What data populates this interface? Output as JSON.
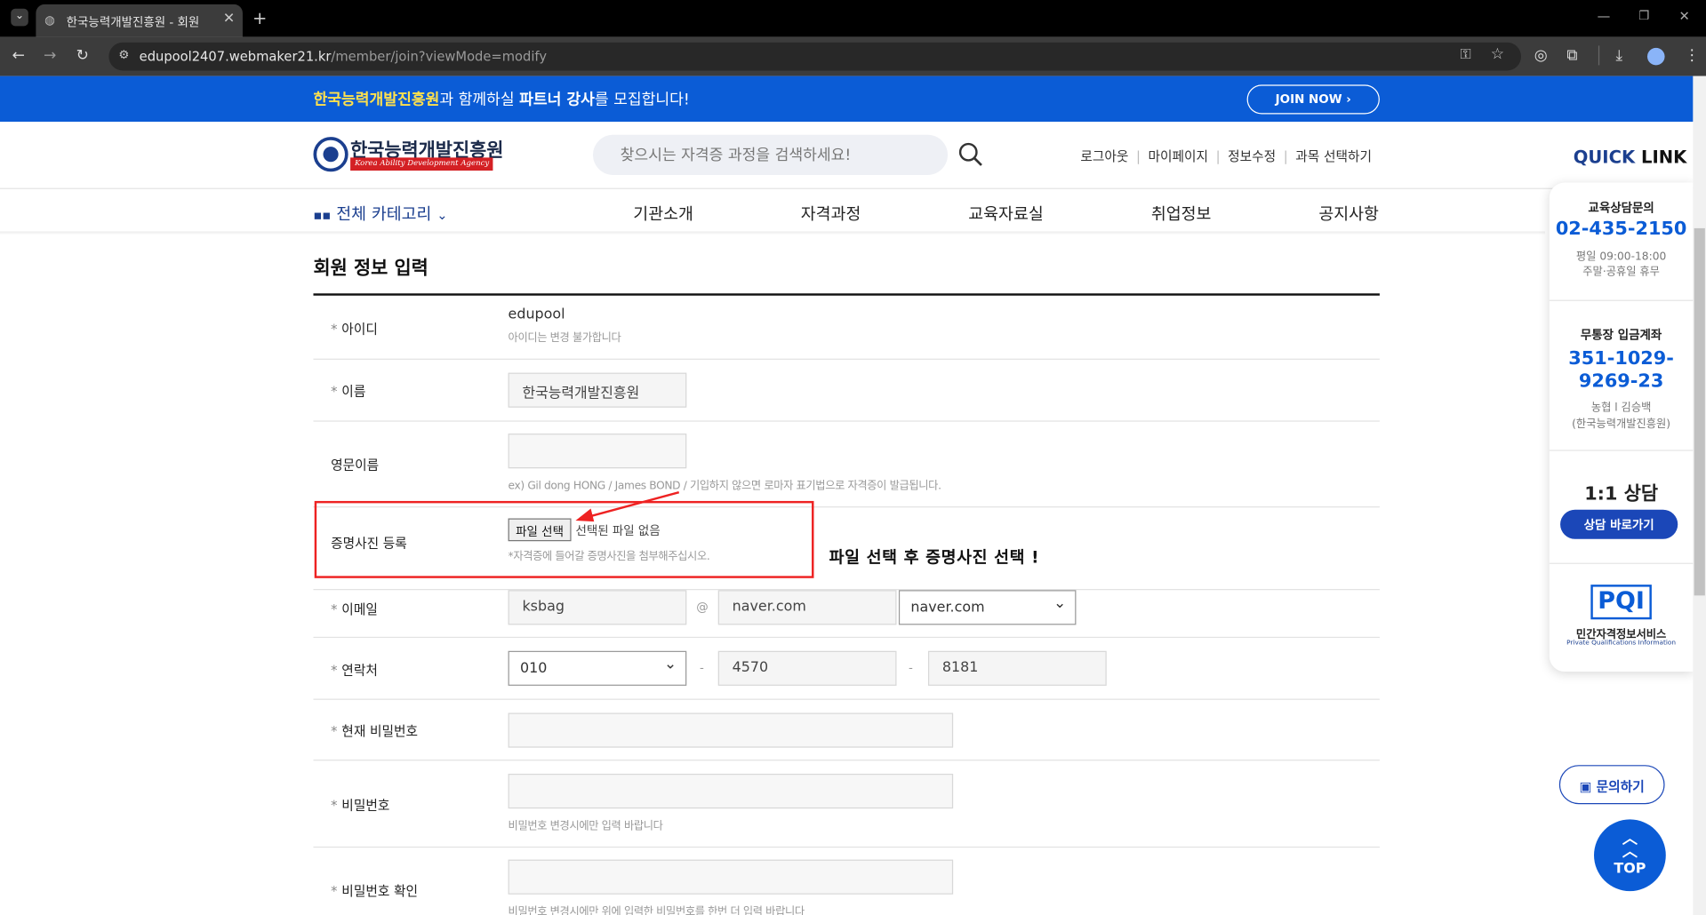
{
  "browser": {
    "tab_title": "한국능력개발진흥원 - 회원",
    "url_host": "edupool2407.webmaker21.kr",
    "url_path": "/member/join?viewMode=modify"
  },
  "banner": {
    "brand": "한국능력개발진흥원",
    "text1": "과 함께하실 ",
    "strong": "파트너 강사",
    "text2": "를 모집합니다!",
    "join_label": "JOIN NOW"
  },
  "header": {
    "logo_ko": "한국능력개발진흥원",
    "logo_en": "Korea Ability Development Agency",
    "search_placeholder": "찾으시는 자격증 과정을 검색하세요!",
    "links": [
      "로그아웃",
      "마이페이지",
      "정보수정",
      "과목 선택하기"
    ],
    "quicklink_1": "QUICK",
    "quicklink_2": "LINK"
  },
  "nav": {
    "all_category": "전체 카테고리",
    "items": [
      "기관소개",
      "자격과정",
      "교육자료실",
      "취업정보",
      "공지사항"
    ]
  },
  "form": {
    "title": "회원 정보 입력",
    "id_label": "아이디",
    "id_value": "edupool",
    "id_help": "아이디는 변경 불가합니다",
    "name_label": "이름",
    "name_value": "한국능력개발진흥원",
    "eng_label": "영문이름",
    "eng_help": "ex) Gil dong HONG / James BOND / 기입하지 않으면 로마자 표기법으로 자격증이 발급됩니다.",
    "photo_label": "증명사진 등록",
    "file_button": "파일 선택",
    "file_status": "선택된 파일 없음",
    "photo_help": "*자격증에 들어갈 증명사진을 첨부해주십시오.",
    "email_label": "이메일",
    "email_user": "ksbag",
    "email_at": "@",
    "email_domain": "naver.com",
    "email_select": "naver.com",
    "phone_label": "연락처",
    "phone_1": "010",
    "phone_2": "4570",
    "phone_3": "8181",
    "phone_dash": "-",
    "curpw_label": "현재 비밀번호",
    "pw_label": "비밀번호",
    "pw_help": "비밀번호 변경시에만 입력 바랍니다",
    "pwc_label": "비밀번호 확인",
    "pwc_help": "비밀번호 변경시에만 위에 입력한 비밀번호를 한번 더 입력 바랍니다",
    "required_mark": "*"
  },
  "annotation": "파일 선택 후 증명사진 선택 !",
  "side": {
    "consult_title": "교육상담문의",
    "consult_phone": "02-435-2150",
    "consult_hours1": "평일 09:00-18:00",
    "consult_hours2": "주말·공휴일 휴무",
    "bank_title": "무통장 입금계좌",
    "bank_no1": "351-1029-",
    "bank_no2": "9269-23",
    "bank_owner1": "농협 l 김승백",
    "bank_owner2": "(한국능력개발진흥원)",
    "chat_title": "1:1 상담",
    "chat_button": "상담 바로가기",
    "pqi_logo": "PQI",
    "pqi_ko": "민간자격정보서비스",
    "pqi_en": "Private Qualifications Information",
    "inquiry": "문의하기",
    "top": "TOP"
  },
  "colors": {
    "brand_blue": "#0b5cd6",
    "annotation_red": "#e22222"
  }
}
